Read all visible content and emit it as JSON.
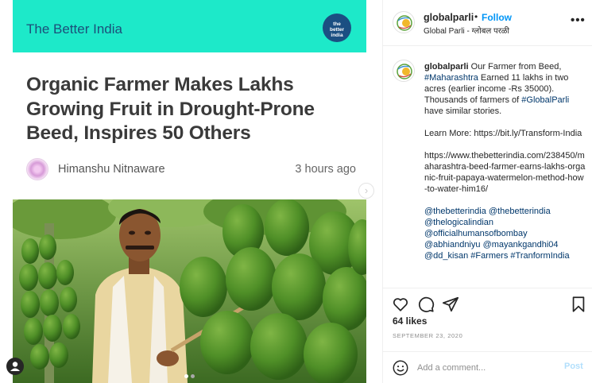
{
  "media": {
    "publisher_name": "The Better India",
    "publisher_logo_text": "the better india",
    "article_title": "Organic Farmer Makes Lakhs Growing Fruit in Drought-Prone Beed, Inspires 50 Others",
    "author": "Himanshu Nitnaware",
    "time_ago": "3 hours ago",
    "carousel": {
      "total": 2,
      "current": 1
    }
  },
  "post": {
    "username": "globalparli",
    "follow_label": "Follow",
    "follow_separator": "•",
    "location": "Global Parli - ग्लोबल परळी",
    "more_label": "•••",
    "caption": {
      "username": "globalparli",
      "intro_1": " Our Farmer from Beed, ",
      "tag_maharashtra": "#Maharashtra",
      "intro_2": " Earned 11 lakhs in two acres (earlier income -Rs 35000). Thousands of farmers of ",
      "tag_globalparli": "#GlobalParli",
      "intro_3": " have similar stories.",
      "learn_more": "Learn More: https://bit.ly/Transform-India",
      "link": "https://www.thebetterindia.com/238450/maharashtra-beed-farmer-earns-lakhs-organic-fruit-papaya-watermelon-method-how-to-water-him16/",
      "mentions": [
        "@thebetterindia",
        "@thebetterindia",
        "@thelogicalindian",
        "@officialhumansofbombay",
        "@abhiandniyu",
        "@mayankgandhi04",
        "@dd_kisan",
        "#Farmers",
        "#TranformIndia"
      ]
    },
    "likes": "64 likes",
    "date": "SEPTEMBER 23, 2020",
    "comment_placeholder": "Add a comment...",
    "post_label": "Post"
  },
  "colors": {
    "brand_teal": "#1de9c9",
    "link_blue": "#00376b",
    "follow_blue": "#0095f6",
    "post_disabled": "#b2dffc"
  }
}
